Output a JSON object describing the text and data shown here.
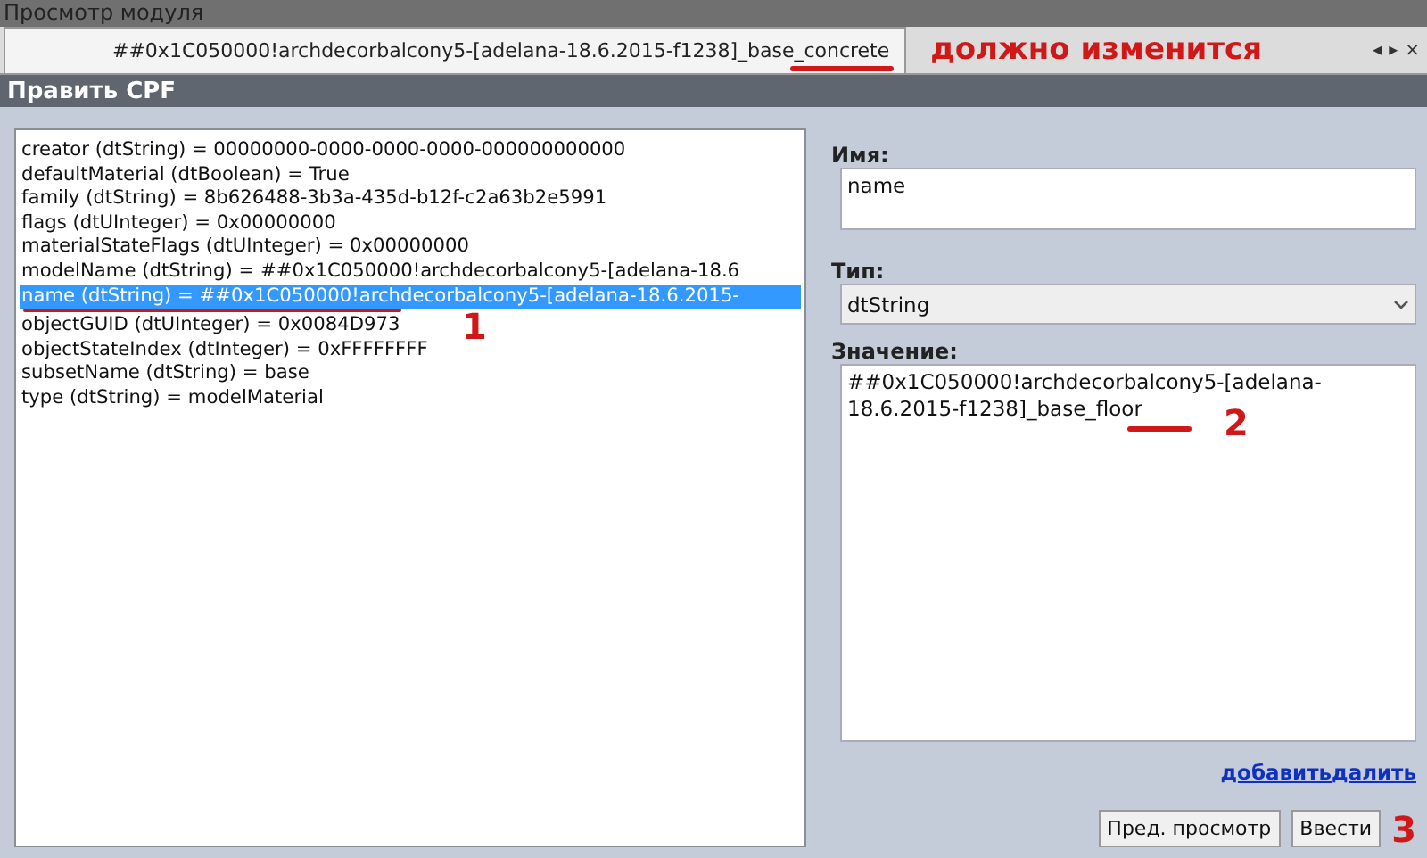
{
  "window": {
    "title": "Просмотр модуля"
  },
  "tab": {
    "title": "##0x1C050000!archdecorbalcony5-[adelana-18.6.2015-f1238]_base_concrete",
    "nav": [
      "◂",
      "▸",
      "×"
    ]
  },
  "panel": {
    "title": "Править CPF"
  },
  "properties": [
    {
      "text": "creator (dtString) = 00000000-0000-0000-0000-000000000000",
      "selected": false
    },
    {
      "text": "defaultMaterial (dtBoolean) = True",
      "selected": false
    },
    {
      "text": "family (dtString) = 8b626488-3b3a-435d-b12f-c2a63b2e5991",
      "selected": false
    },
    {
      "text": "flags (dtUInteger) = 0x00000000",
      "selected": false
    },
    {
      "text": "materialStateFlags (dtUInteger) = 0x00000000",
      "selected": false
    },
    {
      "text": "modelName (dtString) = ##0x1C050000!archdecorbalcony5-[adelana-18.6",
      "selected": false
    },
    {
      "text": "name (dtString) = ##0x1C050000!archdecorbalcony5-[adelana-18.6.2015-",
      "selected": true
    },
    {
      "text": "objectGUID (dtUInteger) = 0x0084D973",
      "selected": false
    },
    {
      "text": "objectStateIndex (dtInteger) = 0xFFFFFFFF",
      "selected": false
    },
    {
      "text": "subsetName (dtString) = base",
      "selected": false
    },
    {
      "text": "type (dtString) = modelMaterial",
      "selected": false
    }
  ],
  "name_field": {
    "label": "Имя:",
    "value": "name"
  },
  "type_field": {
    "label": "Тип:",
    "value": "dtString"
  },
  "value_field": {
    "label": "Значение:",
    "value": "##0x1C050000!archdecorbalcony5-[adelana-18.6.2015-f1238]_base_floor"
  },
  "links": [
    "добавить",
    "далить"
  ],
  "buttons": [
    "Пред. просмотр",
    "Ввести"
  ],
  "annotations": {
    "tab_note": "должно изменится",
    "marks": [
      "1",
      "2",
      "3"
    ]
  }
}
